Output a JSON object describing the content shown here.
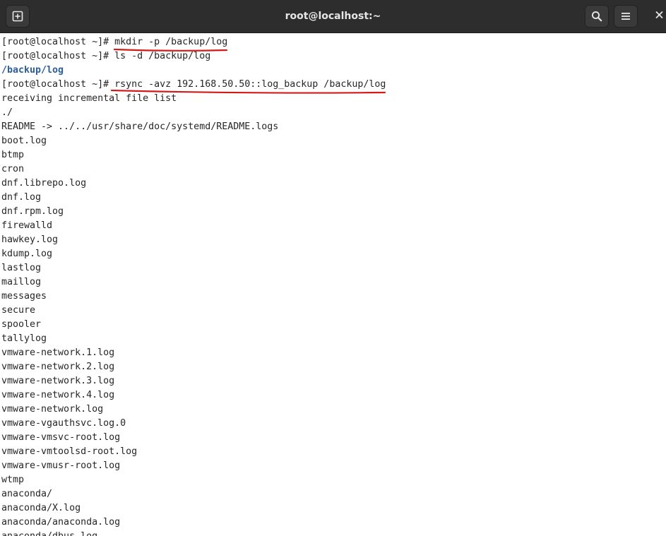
{
  "window": {
    "title": "root@localhost:~"
  },
  "titlebar": {
    "new_tab_icon": "new-tab-icon",
    "search_icon": "search-icon",
    "menu_icon": "hamburger-menu-icon",
    "close_icon": "close-icon"
  },
  "colors": {
    "titlebar_bg": "#2d2d2d",
    "terminal_bg": "#ffffff",
    "terminal_fg": "#262626",
    "directory": "#2a5d9f",
    "annotation_underline": "#d11a1a"
  },
  "terminal": {
    "lines": [
      {
        "prompt": "[root@localhost ~]# ",
        "command": "mkdir -p /backup/log"
      },
      {
        "prompt": "[root@localhost ~]# ",
        "command": "ls -d /backup/log"
      },
      {
        "output": "/backup/log",
        "style": "dir"
      },
      {
        "prompt": "[root@localhost ~]# ",
        "command": "rsync -avz 192.168.50.50::log_backup /backup/log"
      },
      {
        "output": "receiving incremental file list"
      },
      {
        "output": "./"
      },
      {
        "output": "README -> ../../usr/share/doc/systemd/README.logs"
      },
      {
        "output": "boot.log"
      },
      {
        "output": "btmp"
      },
      {
        "output": "cron"
      },
      {
        "output": "dnf.librepo.log"
      },
      {
        "output": "dnf.log"
      },
      {
        "output": "dnf.rpm.log"
      },
      {
        "output": "firewalld"
      },
      {
        "output": "hawkey.log"
      },
      {
        "output": "kdump.log"
      },
      {
        "output": "lastlog"
      },
      {
        "output": "maillog"
      },
      {
        "output": "messages"
      },
      {
        "output": "secure"
      },
      {
        "output": "spooler"
      },
      {
        "output": "tallylog"
      },
      {
        "output": "vmware-network.1.log"
      },
      {
        "output": "vmware-network.2.log"
      },
      {
        "output": "vmware-network.3.log"
      },
      {
        "output": "vmware-network.4.log"
      },
      {
        "output": "vmware-network.log"
      },
      {
        "output": "vmware-vgauthsvc.log.0"
      },
      {
        "output": "vmware-vmsvc-root.log"
      },
      {
        "output": "vmware-vmtoolsd-root.log"
      },
      {
        "output": "vmware-vmusr-root.log"
      },
      {
        "output": "wtmp"
      },
      {
        "output": "anaconda/"
      },
      {
        "output": "anaconda/X.log"
      },
      {
        "output": "anaconda/anaconda.log"
      },
      {
        "output": "anaconda/dbus.log"
      }
    ]
  }
}
